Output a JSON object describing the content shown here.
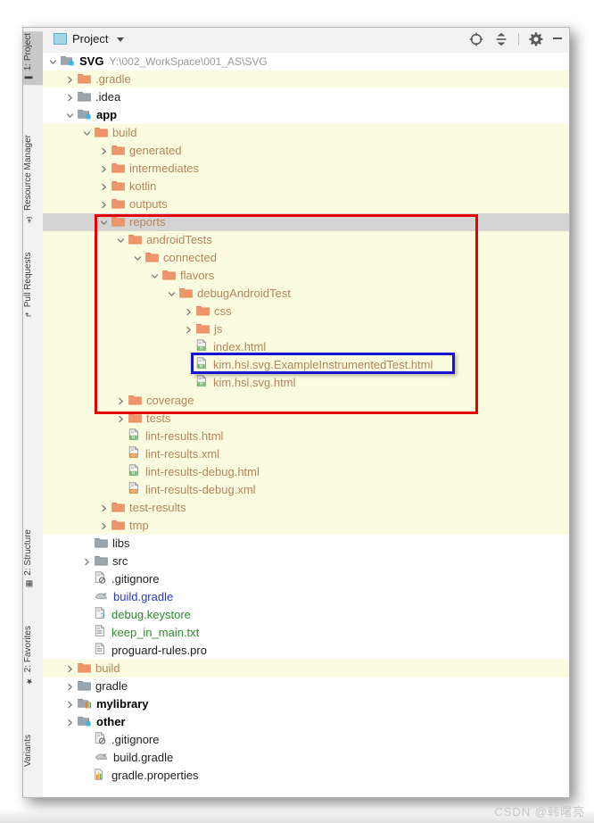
{
  "window": {
    "tool_strip_tabs": [
      {
        "label": "1: Project",
        "icon": "project-folder-icon",
        "selected": true
      },
      {
        "label": "Resource Manager",
        "icon": "resource-manager-icon",
        "selected": false
      },
      {
        "label": "Pull Requests",
        "icon": "pull-request-icon",
        "selected": false
      },
      {
        "label": "2: Structure",
        "icon": "structure-icon",
        "selected": false
      },
      {
        "label": "2: Favorites",
        "icon": "star-icon",
        "selected": false
      },
      {
        "label": "Variants",
        "icon": "build-variants-icon",
        "selected": false
      }
    ]
  },
  "header": {
    "title": "Project",
    "dropdown_caret": "chevron-down-icon",
    "actions": [
      {
        "name": "locate-file-icon",
        "label": "Select Opened File"
      },
      {
        "name": "collapse-all-icon",
        "label": "Collapse All"
      },
      {
        "name": "settings-gear-icon",
        "label": "Settings"
      },
      {
        "name": "minimize-icon",
        "label": "Hide"
      }
    ]
  },
  "tree": {
    "rows": [
      {
        "indent": 0,
        "arrow": "down",
        "icon": "module-folder",
        "text": "SVG",
        "style": "bold",
        "path": "Y:\\002_WorkSpace\\001_AS\\SVG",
        "band": "none"
      },
      {
        "indent": 1,
        "arrow": "right",
        "icon": "folder-orange",
        "text": ".gradle",
        "style": "orange",
        "band": "yellow"
      },
      {
        "indent": 1,
        "arrow": "right",
        "icon": "folder-gray",
        "text": ".idea",
        "style": "plain",
        "band": "none"
      },
      {
        "indent": 1,
        "arrow": "down",
        "icon": "module-folder",
        "text": "app",
        "style": "bold",
        "band": "none"
      },
      {
        "indent": 2,
        "arrow": "down",
        "icon": "folder-orange",
        "text": "build",
        "style": "orange",
        "band": "yellow"
      },
      {
        "indent": 3,
        "arrow": "right",
        "icon": "folder-orange",
        "text": "generated",
        "style": "orange",
        "band": "yellow"
      },
      {
        "indent": 3,
        "arrow": "right",
        "icon": "folder-orange",
        "text": "intermediates",
        "style": "orange",
        "band": "yellow"
      },
      {
        "indent": 3,
        "arrow": "right",
        "icon": "folder-orange",
        "text": "kotlin",
        "style": "orange",
        "band": "yellow"
      },
      {
        "indent": 3,
        "arrow": "right",
        "icon": "folder-orange",
        "text": "outputs",
        "style": "orange",
        "band": "yellow"
      },
      {
        "indent": 3,
        "arrow": "down",
        "icon": "folder-orange",
        "text": "reports",
        "style": "orange",
        "band": "selected"
      },
      {
        "indent": 4,
        "arrow": "down",
        "icon": "folder-orange",
        "text": "androidTests",
        "style": "orange",
        "band": "yellow"
      },
      {
        "indent": 5,
        "arrow": "down",
        "icon": "folder-orange",
        "text": "connected",
        "style": "orange",
        "band": "yellow"
      },
      {
        "indent": 6,
        "arrow": "down",
        "icon": "folder-orange",
        "text": "flavors",
        "style": "orange",
        "band": "yellow"
      },
      {
        "indent": 7,
        "arrow": "down",
        "icon": "folder-orange",
        "text": "debugAndroidTest",
        "style": "orange",
        "band": "yellow"
      },
      {
        "indent": 8,
        "arrow": "right",
        "icon": "folder-orange",
        "text": "css",
        "style": "orange",
        "band": "yellow"
      },
      {
        "indent": 8,
        "arrow": "right",
        "icon": "folder-orange",
        "text": "js",
        "style": "orange",
        "band": "yellow"
      },
      {
        "indent": 8,
        "arrow": "none",
        "icon": "file-html",
        "text": "index.html",
        "style": "orange",
        "band": "yellow"
      },
      {
        "indent": 8,
        "arrow": "none",
        "icon": "file-html",
        "text": "kim.hsl.svg.ExampleInstrumentedTest.html",
        "style": "orange",
        "band": "yellow"
      },
      {
        "indent": 8,
        "arrow": "none",
        "icon": "file-html",
        "text": "kim.hsl.svg.html",
        "style": "orange",
        "band": "yellow"
      },
      {
        "indent": 4,
        "arrow": "right",
        "icon": "folder-orange",
        "text": "coverage",
        "style": "orange",
        "band": "yellow"
      },
      {
        "indent": 4,
        "arrow": "right",
        "icon": "folder-orange",
        "text": "tests",
        "style": "orange",
        "band": "yellow"
      },
      {
        "indent": 4,
        "arrow": "none",
        "icon": "file-html",
        "text": "lint-results.html",
        "style": "orange",
        "band": "yellow"
      },
      {
        "indent": 4,
        "arrow": "none",
        "icon": "file-xml",
        "text": "lint-results.xml",
        "style": "orange",
        "band": "yellow"
      },
      {
        "indent": 4,
        "arrow": "none",
        "icon": "file-html",
        "text": "lint-results-debug.html",
        "style": "orange",
        "band": "yellow"
      },
      {
        "indent": 4,
        "arrow": "none",
        "icon": "file-xml",
        "text": "lint-results-debug.xml",
        "style": "orange",
        "band": "yellow"
      },
      {
        "indent": 3,
        "arrow": "right",
        "icon": "folder-orange",
        "text": "test-results",
        "style": "orange",
        "band": "yellow"
      },
      {
        "indent": 3,
        "arrow": "right",
        "icon": "folder-orange",
        "text": "tmp",
        "style": "orange",
        "band": "yellow"
      },
      {
        "indent": 2,
        "arrow": "none",
        "icon": "folder-gray",
        "text": "libs",
        "style": "plain",
        "band": "none"
      },
      {
        "indent": 2,
        "arrow": "right",
        "icon": "folder-gray",
        "text": "src",
        "style": "plain",
        "band": "none"
      },
      {
        "indent": 2,
        "arrow": "none",
        "icon": "file-gitignore",
        "text": ".gitignore",
        "style": "plain",
        "band": "none"
      },
      {
        "indent": 2,
        "arrow": "none",
        "icon": "file-gradle",
        "text": "build.gradle",
        "style": "blue",
        "band": "none"
      },
      {
        "indent": 2,
        "arrow": "none",
        "icon": "file-keystore",
        "text": "debug.keystore",
        "style": "green",
        "band": "none"
      },
      {
        "indent": 2,
        "arrow": "none",
        "icon": "file-text",
        "text": "keep_in_main.txt",
        "style": "green",
        "band": "none"
      },
      {
        "indent": 2,
        "arrow": "none",
        "icon": "file-text",
        "text": "proguard-rules.pro",
        "style": "plain",
        "band": "none"
      },
      {
        "indent": 1,
        "arrow": "right",
        "icon": "folder-orange",
        "text": "build",
        "style": "orange",
        "band": "yellow"
      },
      {
        "indent": 1,
        "arrow": "right",
        "icon": "folder-gray",
        "text": "gradle",
        "style": "plain",
        "band": "none"
      },
      {
        "indent": 1,
        "arrow": "right",
        "icon": "module-library",
        "text": "mylibrary",
        "style": "bold",
        "band": "none"
      },
      {
        "indent": 1,
        "arrow": "right",
        "icon": "module-folder",
        "text": "other",
        "style": "bold",
        "band": "none"
      },
      {
        "indent": 2,
        "arrow": "none",
        "icon": "file-gitignore",
        "text": ".gitignore",
        "style": "plain",
        "band": "none"
      },
      {
        "indent": 2,
        "arrow": "none",
        "icon": "file-gradle",
        "text": "build.gradle",
        "style": "plain",
        "band": "none"
      },
      {
        "indent": 2,
        "arrow": "none",
        "icon": "file-properties",
        "text": "gradle.properties",
        "style": "plain",
        "band": "none"
      }
    ]
  },
  "annotations": {
    "red_box_color": "#e60000",
    "blue_box_color": "#1414d2",
    "red_box_target": "reports",
    "blue_box_target": "kim.hsl.svg.ExampleInstrumentedTest.html"
  },
  "watermark": {
    "text": "CSDN @韩曙亮"
  }
}
